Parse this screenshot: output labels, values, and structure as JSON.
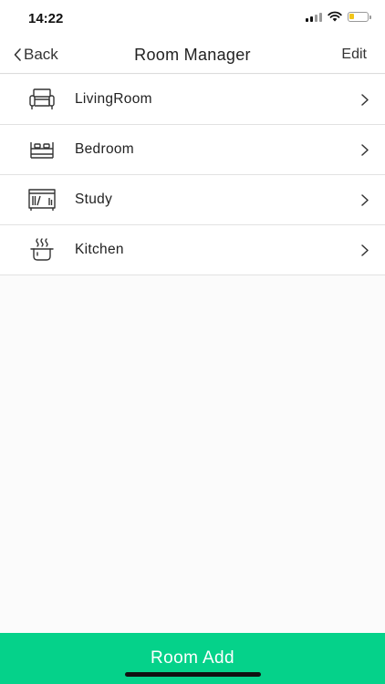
{
  "status_bar": {
    "time": "14:22",
    "battery_level": 0.3,
    "battery_color": "#f2c51a"
  },
  "nav": {
    "back_label": "Back",
    "title": "Room Manager",
    "edit_label": "Edit"
  },
  "rooms": [
    {
      "label": "LivingRoom",
      "icon": "sofa-icon"
    },
    {
      "label": "Bedroom",
      "icon": "bed-icon"
    },
    {
      "label": "Study",
      "icon": "bookshelf-icon"
    },
    {
      "label": "Kitchen",
      "icon": "cooking-pot-icon"
    }
  ],
  "footer": {
    "add_label": "Room Add",
    "accent_color": "#05d28a"
  }
}
